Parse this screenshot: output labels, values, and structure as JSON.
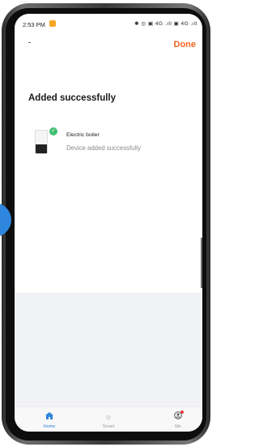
{
  "status_bar": {
    "time": "2:53 PM",
    "system_icons": "✱ ◎ ▣ 4G .ıll ▣ 4G .ıll"
  },
  "header": {
    "done_label": "Done"
  },
  "main": {
    "title": "Added successfully",
    "device": {
      "name": "Electric boiler",
      "status": "Device added successfully"
    }
  },
  "tabbar": {
    "items": [
      {
        "label": "Home",
        "icon": "home-icon"
      },
      {
        "label": "Smart",
        "icon": "sun-icon"
      },
      {
        "label": "Me",
        "icon": "user-icon"
      }
    ]
  },
  "colors": {
    "accent": "#f26522",
    "success": "#3fbf6f",
    "active_tab": "#2e86de"
  }
}
